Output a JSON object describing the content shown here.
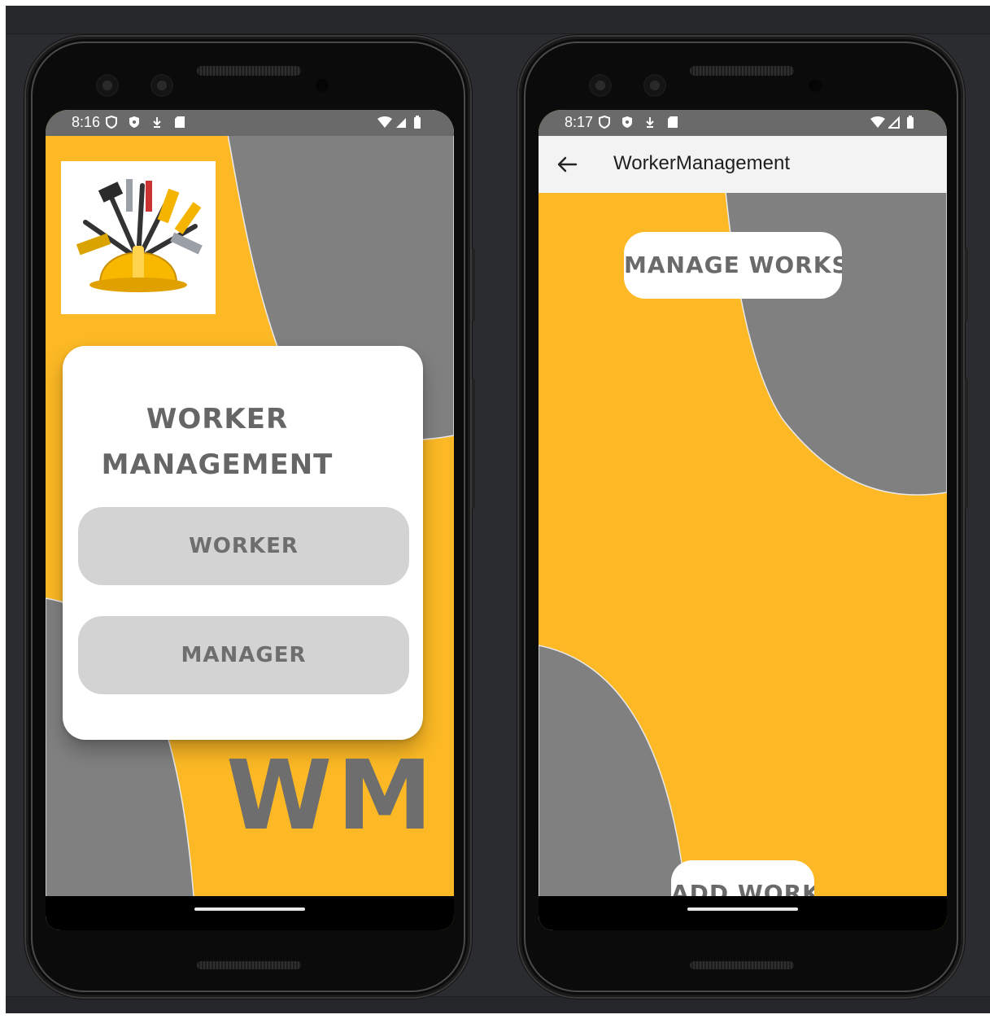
{
  "left_phone": {
    "status_bar": {
      "time": "8:16"
    },
    "login_card": {
      "title_line1": "WORKER",
      "title_line2": "MANAGEMENT",
      "worker_button": "WORKER",
      "manager_button": "MANAGER"
    },
    "brand_mark": "WM",
    "logo_icon": "worker-tools-helmet-logo"
  },
  "right_phone": {
    "status_bar": {
      "time": "8:17"
    },
    "app_bar": {
      "back_icon": "arrow-left",
      "title": "WorkerManagement"
    },
    "manage_works_button": "MANAGE WORKS",
    "add_work_button": "ADD WORK"
  },
  "colors": {
    "accent_yellow": "#fcb925",
    "shape_gray": "#808080",
    "button_gray": "#d3d3d3",
    "text_gray": "#6e6e6e"
  }
}
